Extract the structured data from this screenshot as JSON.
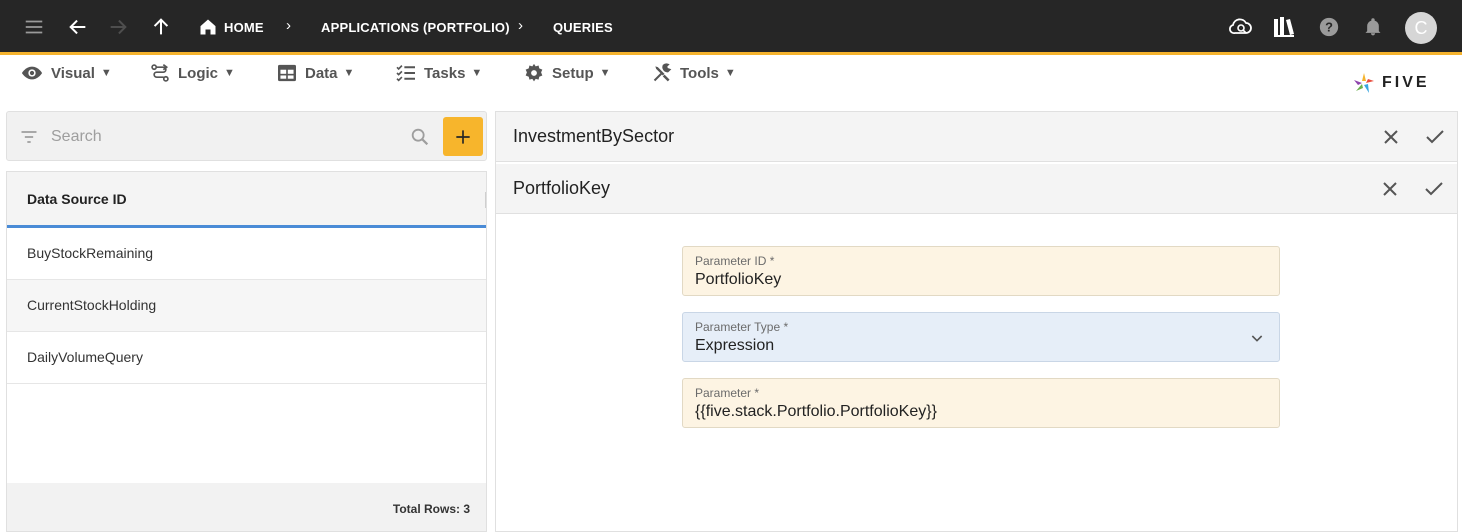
{
  "topbar": {
    "breadcrumbs": {
      "home": "HOME",
      "applications": "APPLICATIONS (PORTFOLIO)",
      "queries": "QUERIES"
    },
    "avatar_initial": "C",
    "accent_color": "#f5b32e",
    "icons": [
      "menu-icon",
      "back-arrow-icon",
      "forward-arrow-icon",
      "up-arrow-icon",
      "home-icon",
      "cloud-search-icon",
      "library-icon",
      "help-icon",
      "bell-icon"
    ]
  },
  "menubar": {
    "items": [
      {
        "label": "Visual",
        "icon": "eye-icon"
      },
      {
        "label": "Logic",
        "icon": "logic-icon"
      },
      {
        "label": "Data",
        "icon": "table-icon"
      },
      {
        "label": "Tasks",
        "icon": "tasks-icon"
      },
      {
        "label": "Setup",
        "icon": "gear-icon"
      },
      {
        "label": "Tools",
        "icon": "tools-icon"
      }
    ],
    "caret": "▼",
    "logo_text": "FIVE"
  },
  "left": {
    "search_placeholder": "Search",
    "column_header": "Data Source ID",
    "rows": [
      "BuyStockRemaining",
      "CurrentStockHolding",
      "DailyVolumeQuery"
    ],
    "total_rows": "Total Rows: 3"
  },
  "right": {
    "record_title": "InvestmentBySector",
    "sub_title": "PortfolioKey",
    "fields": {
      "parameter_id": {
        "label": "Parameter ID *",
        "value": "PortfolioKey"
      },
      "parameter_type": {
        "label": "Parameter Type *",
        "value": "Expression"
      },
      "parameter": {
        "label": "Parameter *",
        "value": "{{five.stack.Portfolio.PortfolioKey}}"
      }
    }
  }
}
